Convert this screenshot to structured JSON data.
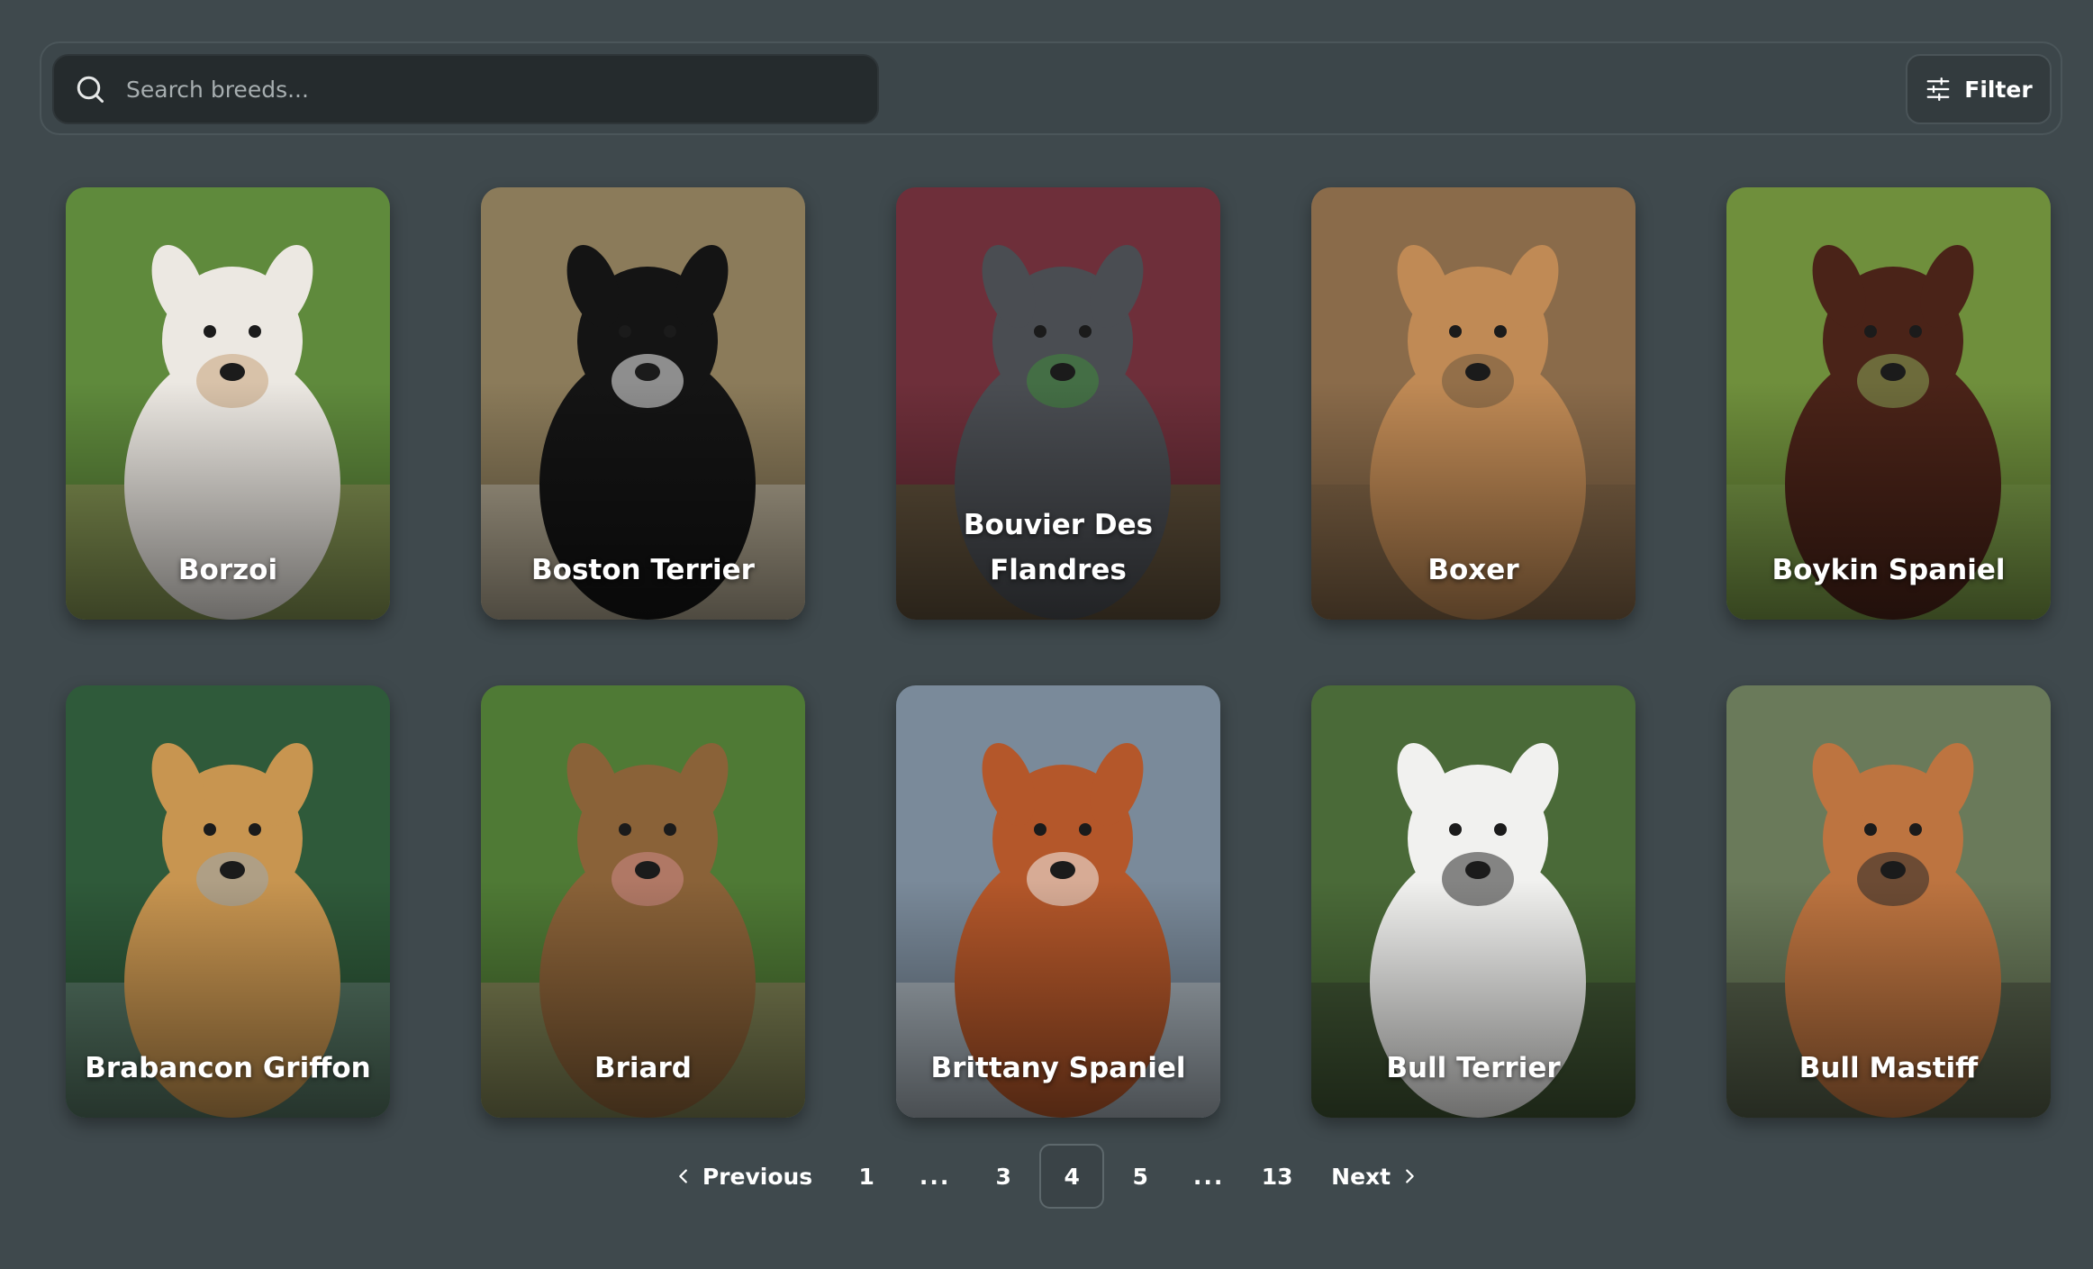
{
  "search": {
    "placeholder": "Search breeds..."
  },
  "filter": {
    "label": "Filter"
  },
  "breeds": [
    {
      "name": "Borzoi",
      "bg": "#5f8a3c",
      "dog": "#ece8e2",
      "accent": "#c9a27a"
    },
    {
      "name": "Boston Terrier",
      "bg": "#8b7b5a",
      "dog": "#141414",
      "accent": "#f2f2f2"
    },
    {
      "name": "Bouvier Des Flandres",
      "bg": "#6e2f3a",
      "dog": "#4a4d52",
      "accent": "#3f8a3a"
    },
    {
      "name": "Boxer",
      "bg": "#8a6b4a",
      "dog": "#c08a55",
      "accent": "#6e5a40"
    },
    {
      "name": "Boykin Spaniel",
      "bg": "#6f8f3c",
      "dog": "#4a2318",
      "accent": "#8aa85a"
    },
    {
      "name": "Brabancon Griffon",
      "bg": "#2f5a3a",
      "dog": "#c89550",
      "accent": "#9aa7b0"
    },
    {
      "name": "Briard",
      "bg": "#4f7a35",
      "dog": "#8a6238",
      "accent": "#d08a8a"
    },
    {
      "name": "Brittany Spaniel",
      "bg": "#7a8a9a",
      "dog": "#b4572a",
      "accent": "#f4f1ec"
    },
    {
      "name": "Bull Terrier",
      "bg": "#4a6a38",
      "dog": "#f1f1ef",
      "accent": "#2a2a2a"
    },
    {
      "name": "Bull Mastiff",
      "bg": "#6a7a5a",
      "dog": "#bd7440",
      "accent": "#2a2a2a"
    }
  ],
  "pagination": {
    "previous": "Previous",
    "next": "Next",
    "pages": [
      "1",
      "...",
      "3",
      "4",
      "5",
      "...",
      "13"
    ],
    "current": "4"
  }
}
